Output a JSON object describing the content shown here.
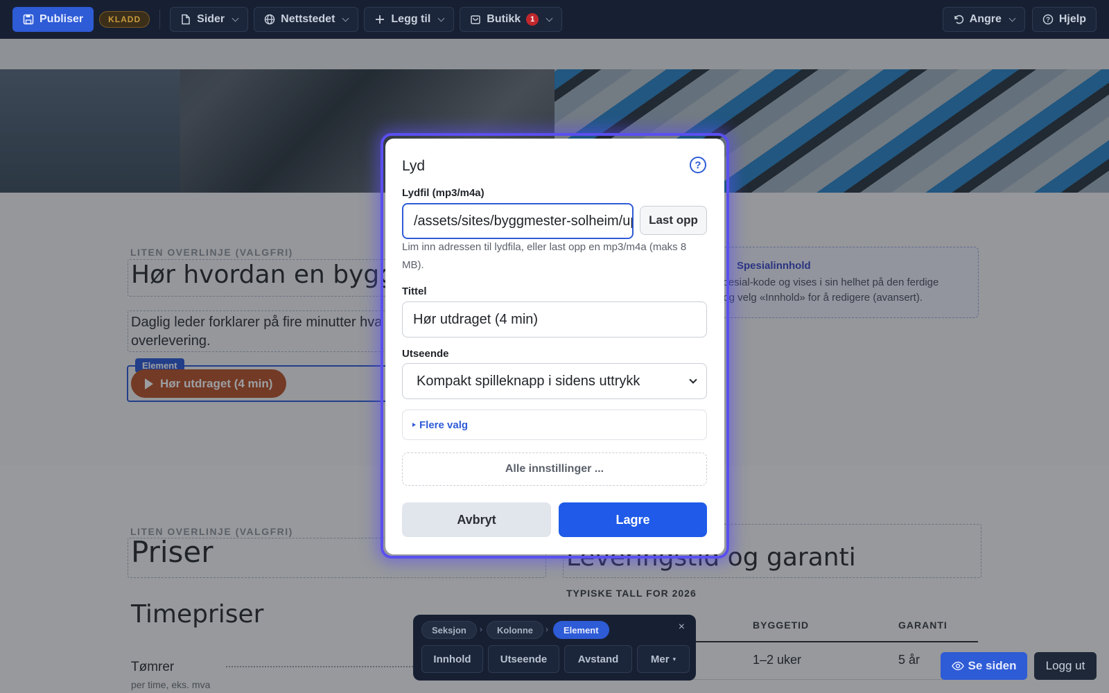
{
  "toolbar": {
    "publish_label": "Publiser",
    "draft_badge": "KLADD",
    "pages_label": "Sider",
    "site_label": "Nettstedet",
    "add_label": "Legg til",
    "shop_label": "Butikk",
    "shop_count": "1",
    "undo_label": "Angre",
    "help_label": "Hjelp"
  },
  "page": {
    "overline_1": "LITEN OVERLINJE (VALGFRI)",
    "heading_1": "Hør hvordan en byggep",
    "paragraph_1_line1": "Daglig leder forklarer på fire minutter hva",
    "paragraph_1_line2": "overlevering.",
    "element_tag": "Element",
    "audio_button": "Hør utdraget (4 min)",
    "special_title": "Spesialinnhold",
    "special_line1": "spesial-kode og vises i sin helhet på den ferdige",
    "special_line2": "t og velg «Innhold» for å redigere (avansert).",
    "overline_2": "LITEN OVERLINJE (VALGFRI)",
    "heading_2": "Priser",
    "heading_3": "Leveringstid og garanti",
    "subhead_3": "TYPISKE TALL FOR 2026",
    "rates_heading": "Timepriser",
    "rate_item": "Tømrer",
    "rate_note": "per time, eks. mva",
    "table_headers": [
      "BYGGETID",
      "GARANTI"
    ],
    "table_rows": [
      [
        "1–2 uker",
        "5 år"
      ]
    ]
  },
  "modal": {
    "title": "Lyd",
    "file_label": "Lydfil (mp3/m4a)",
    "file_value": "/assets/sites/byggmester-solheim/up",
    "upload_button": "Last opp",
    "hint": "Lim inn adressen til lydfila, eller last opp en mp3/m4a (maks 8 MB).",
    "title_label": "Tittel",
    "title_value": "Hør utdraget (4 min)",
    "appearance_label": "Utseende",
    "appearance_value": "Kompakt spilleknapp i sidens uttrykk",
    "more_options": "Flere valg",
    "all_settings": "Alle innstillinger ...",
    "cancel": "Avbryt",
    "save": "Lagre"
  },
  "floating": {
    "crumbs": [
      "Seksjon",
      "Kolonne",
      "Element"
    ],
    "close": "×",
    "buttons": [
      "Innhold",
      "Utseende",
      "Avstand",
      "Mer"
    ]
  },
  "corner": {
    "view_site": "Se siden",
    "logout": "Logg ut"
  },
  "colors": {
    "accent": "#2e5bd6",
    "modal_glow": "#5a4ff0",
    "audio_pill": "#b8532a",
    "topbar": "#172033"
  }
}
